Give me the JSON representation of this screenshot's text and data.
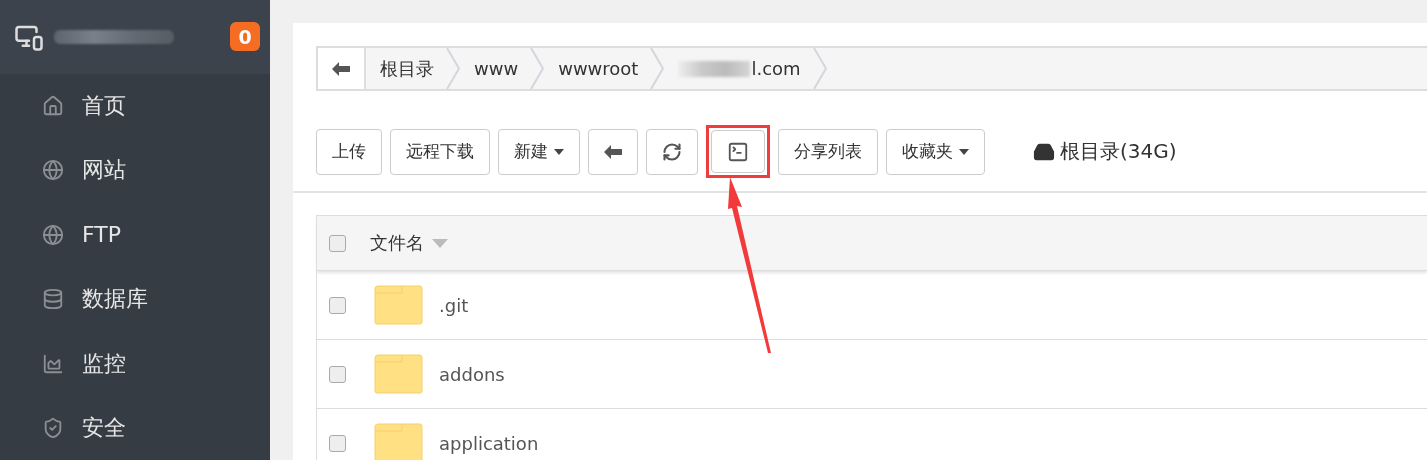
{
  "sidebar": {
    "badge": "0",
    "items": [
      {
        "label": "首页"
      },
      {
        "label": "网站"
      },
      {
        "label": "FTP"
      },
      {
        "label": "数据库"
      },
      {
        "label": "监控"
      },
      {
        "label": "安全"
      }
    ]
  },
  "breadcrumb": {
    "items": [
      {
        "label": "根目录",
        "redacted": false
      },
      {
        "label": "www",
        "redacted": false
      },
      {
        "label": "wwwroot",
        "redacted": false
      },
      {
        "label": "l.com",
        "redacted": true
      }
    ]
  },
  "toolbar": {
    "buttons": [
      {
        "kind": "text",
        "label": "上传",
        "highlighted": false
      },
      {
        "kind": "text",
        "label": "远程下载",
        "highlighted": false
      },
      {
        "kind": "dropdown",
        "label": "新建",
        "highlighted": false
      },
      {
        "kind": "back",
        "highlighted": false
      },
      {
        "kind": "refresh",
        "highlighted": false
      },
      {
        "kind": "terminal",
        "highlighted": true
      },
      {
        "kind": "text",
        "label": "分享列表",
        "highlighted": false
      },
      {
        "kind": "dropdown",
        "label": "收藏夹",
        "highlighted": false
      }
    ],
    "disk": "根目录(34G)"
  },
  "table": {
    "all_checked": false,
    "columns": [
      {
        "label": "文件名"
      }
    ],
    "rows": [
      {
        "name": ".git",
        "checked": false
      },
      {
        "name": "addons",
        "checked": false
      },
      {
        "name": "application",
        "checked": false
      }
    ]
  }
}
